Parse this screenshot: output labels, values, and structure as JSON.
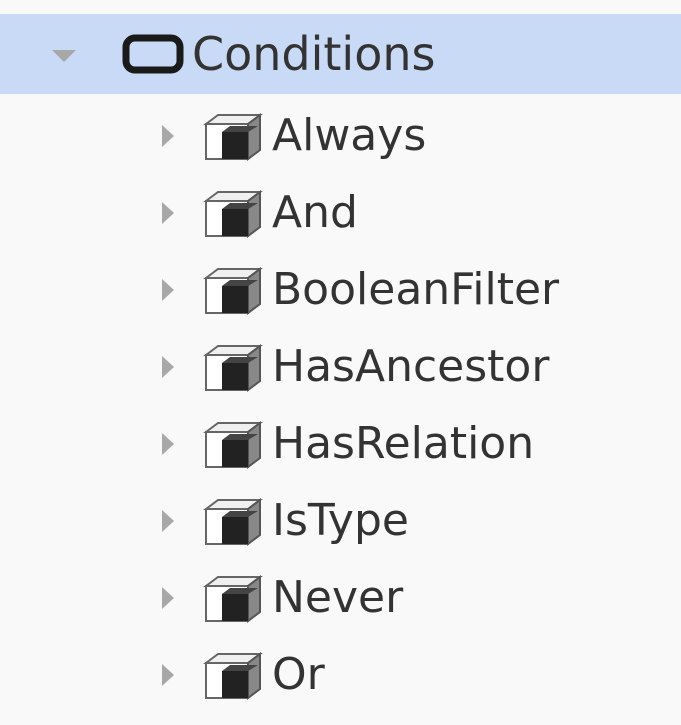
{
  "tree": {
    "root": {
      "label": "Conditions",
      "expanded": true,
      "selected": true,
      "icon": "folder-icon"
    },
    "children": [
      {
        "label": "Always",
        "icon": "cube-icon",
        "expanded": false
      },
      {
        "label": "And",
        "icon": "cube-icon",
        "expanded": false
      },
      {
        "label": "BooleanFilter",
        "icon": "cube-icon",
        "expanded": false
      },
      {
        "label": "HasAncestor",
        "icon": "cube-icon",
        "expanded": false
      },
      {
        "label": "HasRelation",
        "icon": "cube-icon",
        "expanded": false
      },
      {
        "label": "IsType",
        "icon": "cube-icon",
        "expanded": false
      },
      {
        "label": "Never",
        "icon": "cube-icon",
        "expanded": false
      },
      {
        "label": "Or",
        "icon": "cube-icon",
        "expanded": false
      }
    ]
  },
  "colors": {
    "selection": "#c9daf6",
    "text": "#333333",
    "toggle": "#a8a8a8"
  }
}
